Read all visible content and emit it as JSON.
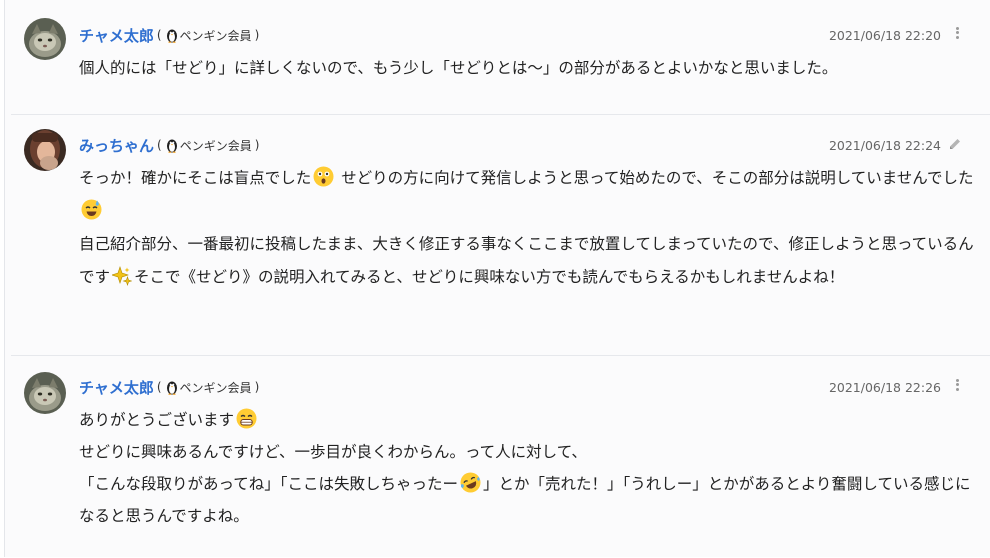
{
  "comments": [
    {
      "author": "チャメ太郎",
      "paren_open": "(",
      "rank": "ペンギン会員",
      "paren_close": ")",
      "timestamp": "2021/06/18 22:20",
      "action_icon": "more-vertical-icon",
      "lines": [
        "個人的には「せどり」に詳しくないので、もう少し「せどりとは〜」の部分があるとよいかなと思いました。"
      ]
    },
    {
      "author": "みっちゃん",
      "paren_open": "(",
      "rank": "ペンギン会員",
      "paren_close": ")",
      "timestamp": "2021/06/18 22:24",
      "action_icon": "pencil-icon",
      "p1_a": "そっか！確かにそこは盲点でした",
      "p1_b": " せどりの方に向けて発信しようと思って始めたので、そこの部分は説明していませんでした",
      "p2_a": "自己紹介部分、一番最初に投稿したまま、大きく修正する事なくここまで放置してしまっていたので、修正しようと思っているんです",
      "p2_b": "そこで《せどり》の説明入れてみると、せどりに興味ない方でも読んでもらえるかもしれませんよね！"
    },
    {
      "author": "チャメ太郎",
      "paren_open": "(",
      "rank": "ペンギン会員",
      "paren_close": ")",
      "timestamp": "2021/06/18 22:26",
      "action_icon": "more-vertical-icon",
      "l1": "ありがとうございます",
      "l2": "せどりに興味あるんですけど、一歩目が良くわからん。って人に対して、",
      "l3_a": "「こんな段取りがあってね」「ここは失敗しちゃったー",
      "l3_b": "」とか「売れた！」「うれしー」とかがあるとより奮闘している感じになると思うんですよね。"
    }
  ],
  "emoji": {
    "astonished": "astonished-face-icon",
    "sweat": "sweat-smile-icon",
    "sparkles": "sparkles-icon",
    "grin": "grinning-face-icon",
    "rofl": "rolling-laughing-icon"
  },
  "colors": {
    "author_name": "#2f6fd0",
    "timestamp": "#666666",
    "divider": "#e6e8ec"
  }
}
